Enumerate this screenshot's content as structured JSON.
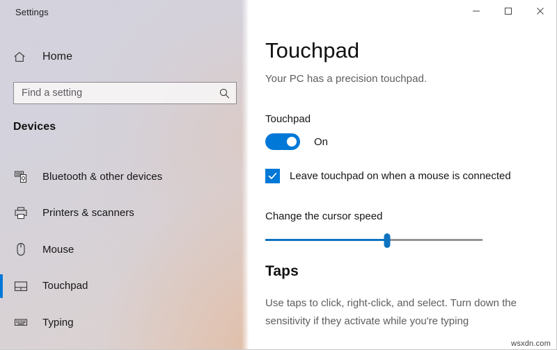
{
  "window": {
    "app_title": "Settings",
    "controls": [
      {
        "name": "minimize",
        "label": "–",
        "tooltip": "Minimize"
      },
      {
        "name": "maximize",
        "label": "□",
        "tooltip": "Maximize"
      },
      {
        "name": "close",
        "label": "×",
        "tooltip": "Close"
      }
    ]
  },
  "sidebar": {
    "home": {
      "label": "Home",
      "icon": "home-icon"
    },
    "search": {
      "value": "",
      "placeholder": "Find a setting",
      "icon": "search-icon"
    },
    "category_heading": "Devices",
    "items": [
      {
        "label": "Bluetooth & other devices",
        "icon": "bluetooth-devices-icon",
        "selected": false
      },
      {
        "label": "Printers & scanners",
        "icon": "printer-icon",
        "selected": false
      },
      {
        "label": "Mouse",
        "icon": "mouse-icon",
        "selected": false
      },
      {
        "label": "Touchpad",
        "icon": "touchpad-icon",
        "selected": true
      },
      {
        "label": "Typing",
        "icon": "keyboard-icon",
        "selected": false
      }
    ]
  },
  "main": {
    "page_title": "Touchpad",
    "page_subtitle": "Your PC has a precision touchpad.",
    "touchpad_toggle": {
      "group_label": "Touchpad",
      "state_label": "On",
      "checked": true
    },
    "mouse_checkbox": {
      "label": "Leave touchpad on when a mouse is connected",
      "checked": true
    },
    "cursor_speed": {
      "label": "Change the cursor speed",
      "value": 56,
      "min": 0,
      "max": 100
    },
    "taps_section": {
      "title": "Taps",
      "description": "Use taps to click, right-click, and select. Turn down the sensitivity if they activate while you're typing"
    }
  },
  "watermark": {
    "text": "wsxdn.com"
  },
  "colors": {
    "accent": "#0078d7",
    "slider_fill": "#0d73c0",
    "selection_bar": "#0078d7",
    "content_bg": "#ffffff",
    "text_primary": "#151515",
    "text_secondary": "#5d5d5d"
  }
}
